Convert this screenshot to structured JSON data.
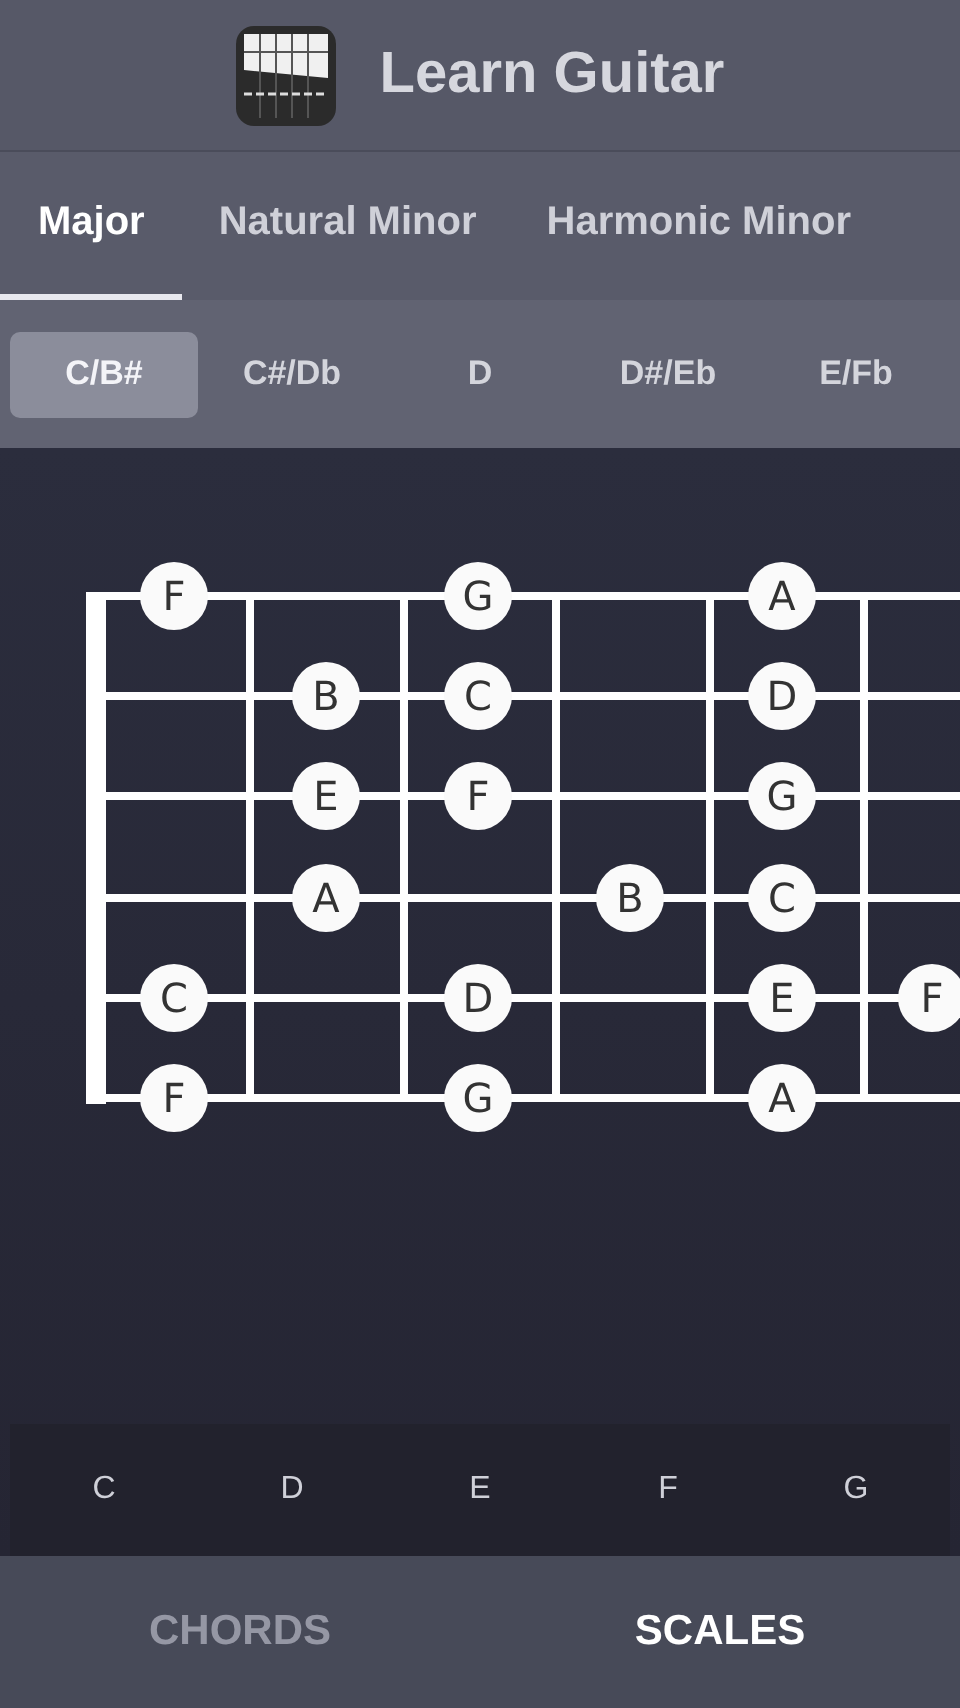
{
  "header": {
    "title": "Learn Guitar"
  },
  "scale_tabs": [
    {
      "label": "Major",
      "selected": true
    },
    {
      "label": "Natural Minor",
      "selected": false
    },
    {
      "label": "Harmonic Minor",
      "selected": false
    }
  ],
  "keys": [
    {
      "label": "C/B#",
      "selected": true
    },
    {
      "label": "C#/Db",
      "selected": false
    },
    {
      "label": "D",
      "selected": false
    },
    {
      "label": "D#/Eb",
      "selected": false
    },
    {
      "label": "E/Fb",
      "selected": false
    }
  ],
  "fretboard": {
    "strings": [
      {
        "frets": [
          {
            "kind": "note",
            "label": "F"
          },
          {
            "kind": "empty"
          },
          {
            "kind": "note",
            "label": "G"
          },
          {
            "kind": "empty"
          },
          {
            "kind": "note",
            "label": "A"
          },
          {
            "kind": "empty"
          }
        ]
      },
      {
        "frets": [
          {
            "kind": "empty"
          },
          {
            "kind": "note",
            "label": "B"
          },
          {
            "kind": "note",
            "label": "C"
          },
          {
            "kind": "empty"
          },
          {
            "kind": "note",
            "label": "D"
          },
          {
            "kind": "empty"
          }
        ]
      },
      {
        "frets": [
          {
            "kind": "empty"
          },
          {
            "kind": "note",
            "label": "E"
          },
          {
            "kind": "note",
            "label": "F"
          },
          {
            "kind": "empty"
          },
          {
            "kind": "note",
            "label": "G"
          },
          {
            "kind": "empty"
          }
        ]
      },
      {
        "frets": [
          {
            "kind": "empty"
          },
          {
            "kind": "note",
            "label": "A"
          },
          {
            "kind": "empty"
          },
          {
            "kind": "note",
            "label": "B"
          },
          {
            "kind": "note",
            "label": "C"
          },
          {
            "kind": "empty"
          }
        ]
      },
      {
        "frets": [
          {
            "kind": "note",
            "label": "C"
          },
          {
            "kind": "empty"
          },
          {
            "kind": "note",
            "label": "D"
          },
          {
            "kind": "empty"
          },
          {
            "kind": "note",
            "label": "E"
          },
          {
            "kind": "note",
            "label": "F"
          }
        ]
      },
      {
        "frets": [
          {
            "kind": "note",
            "label": "F"
          },
          {
            "kind": "empty"
          },
          {
            "kind": "note",
            "label": "G"
          },
          {
            "kind": "empty"
          },
          {
            "kind": "note",
            "label": "A"
          },
          {
            "kind": "empty"
          }
        ]
      }
    ]
  },
  "scale_notes": [
    "C",
    "D",
    "E",
    "F",
    "G"
  ],
  "bottom_nav": [
    {
      "label": "CHORDS",
      "selected": false
    },
    {
      "label": "SCALES",
      "selected": true
    }
  ]
}
